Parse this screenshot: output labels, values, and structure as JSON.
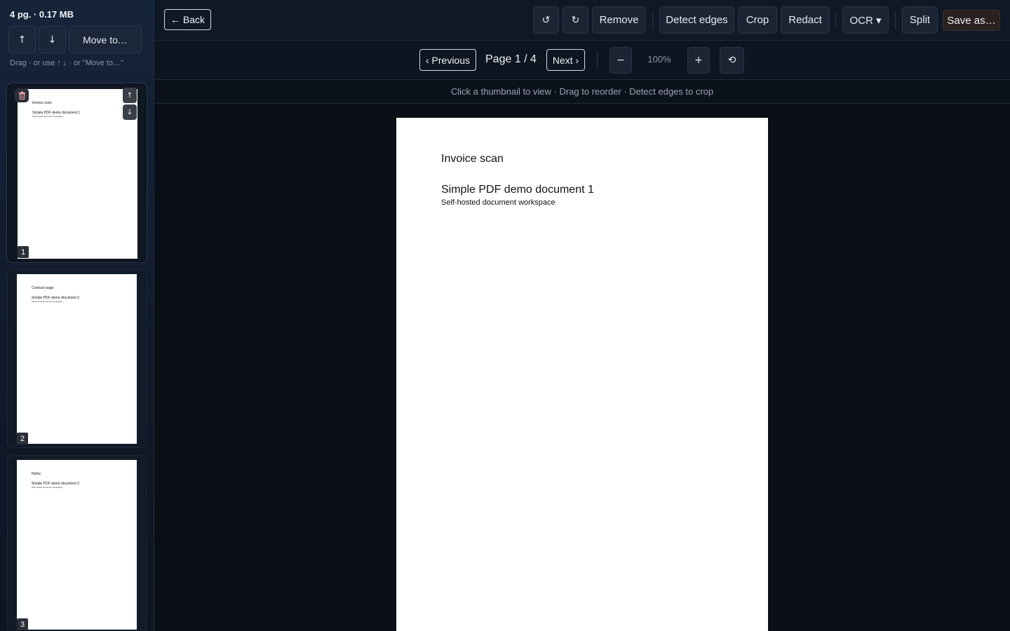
{
  "sidebar": {
    "info": "4 pg. · 0.17 MB",
    "move_up": "↑",
    "move_down": "↓",
    "move_to": "Move to…",
    "hint": "Drag · or use ↑ ↓ · or \"Move to…\"",
    "thumbnails": [
      {
        "number": "1",
        "title": "Invoice scan",
        "doc": "Simple PDF demo document 1",
        "sub": "Self-hosted document workspace",
        "up": "↑",
        "down": "↓"
      },
      {
        "number": "2",
        "title": "Contract page",
        "doc": "Simple PDF demo document 2",
        "sub": "Self-hosted document workspace"
      },
      {
        "number": "3",
        "title": "Notes",
        "doc": "Simple PDF demo document 3",
        "sub": "Self-hosted document workspace"
      }
    ]
  },
  "toolbar": {
    "back": "← Back",
    "rotate_left": "↺",
    "rotate_right": "↻",
    "remove": "Remove",
    "detect_edges": "Detect edges",
    "crop": "Crop",
    "redact": "Redact",
    "ocr": "OCR ▾",
    "split": "Split",
    "save_as": "Save as…"
  },
  "nav": {
    "previous": "‹ Previous",
    "page_indicator": "Page 1 / 4",
    "next": "Next ›",
    "zoom_out": "−",
    "zoom_level": "100%",
    "zoom_in": "+",
    "reset_zoom": "⟲"
  },
  "hint": "Click a thumbnail to view · Drag to reorder · Detect edges to crop",
  "page": {
    "title": "Invoice scan",
    "doc": "Simple PDF demo document 1",
    "sub": "Self-hosted document workspace"
  }
}
